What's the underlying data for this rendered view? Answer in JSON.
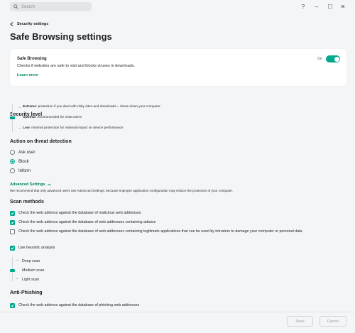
{
  "search": {
    "placeholder": "Search"
  },
  "window": {
    "help": "?",
    "minimize": "–",
    "maximize": "☐",
    "close": "✕"
  },
  "breadcrumb": "Security settings",
  "page_title": "Safe Browsing settings",
  "safe_browsing": {
    "title": "Safe Browsing",
    "description": "Checks if websites are safe to visit and blocks viruses in downloads.",
    "learn_more": "Learn more",
    "toggle_label": "On",
    "enabled": true
  },
  "security_level": {
    "title": "Security level",
    "levels": [
      {
        "name": "Extreme",
        "desc": ": protection if you deal with risky sites and downloads – slows down your computer"
      },
      {
        "name": "Optimal",
        "desc": ": recommended for most users"
      },
      {
        "name": "Low",
        "desc": ": minimal protection for minimal impact on device performance"
      }
    ],
    "selected": "Optimal"
  },
  "threat_action": {
    "title": "Action on threat detection",
    "options": [
      "Ask user",
      "Block",
      "Inform"
    ],
    "selected": "Block"
  },
  "advanced": {
    "label": "Advanced Settings",
    "note": "We recommend that only advanced users use Advanced Settings, because improper application configuration may reduce the protection of your computer."
  },
  "scan_methods": {
    "title": "Scan methods",
    "items": [
      {
        "label": "Check the web address against the database of malicious web addresses",
        "checked": true
      },
      {
        "label": "Check the web address against the database of web addresses containing adware",
        "checked": true
      },
      {
        "label": "Check the web address against the database of web addresses containing legitimate applications that can be used by intruders to damage your computer or personal data",
        "checked": false
      },
      {
        "label": "Use heuristic analysis",
        "checked": true
      }
    ],
    "heuristic_levels": [
      "Deep scan",
      "Medium scan",
      "Light scan"
    ],
    "heuristic_selected": "Medium scan"
  },
  "anti_phishing": {
    "title": "Anti-Phishing",
    "items": [
      {
        "label": "Check the web address against the database of phishing web addresses",
        "checked": true
      }
    ]
  },
  "footer": {
    "save": "Save",
    "cancel": "Cancel"
  },
  "colors": {
    "accent": "#00a88e",
    "link": "#00875a",
    "background": "#f4f5f6"
  }
}
